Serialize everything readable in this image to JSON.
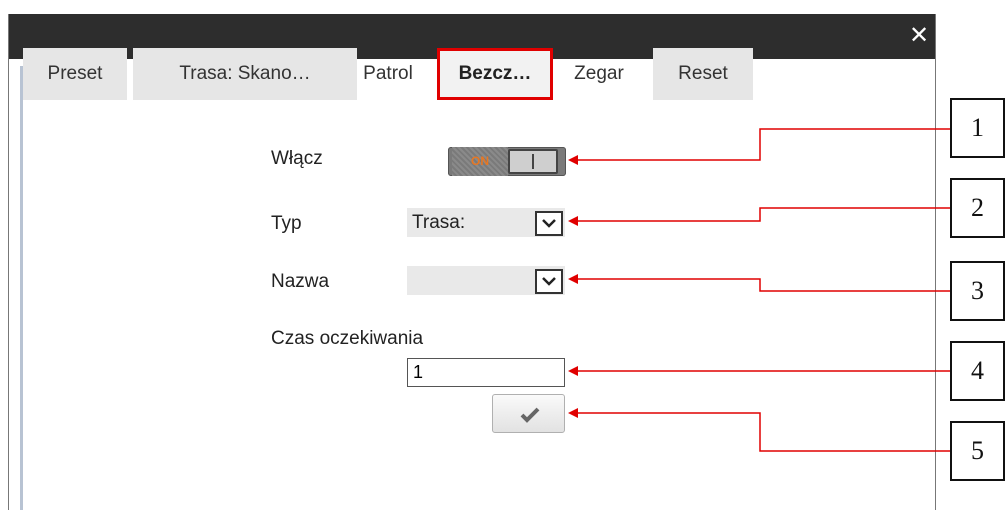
{
  "window": {
    "close_symbol": "✕"
  },
  "tabs": [
    {
      "label": "Preset"
    },
    {
      "label": "Trasa: Skano…"
    },
    {
      "label": "Patrol"
    },
    {
      "label": "Bezcz…",
      "active": true
    },
    {
      "label": "Zegar"
    },
    {
      "label": "Reset"
    }
  ],
  "form": {
    "enable_label": "Włącz",
    "enable_toggle_text": "ON",
    "enable_state": "on",
    "type_label": "Typ",
    "type_value": "Trasa:",
    "name_label": "Nazwa",
    "name_value": "",
    "wait_label": "Czas oczekiwania",
    "wait_value": "1",
    "confirm_icon": "checkmark-icon"
  },
  "callouts": [
    "1",
    "2",
    "3",
    "4",
    "5"
  ],
  "colors": {
    "highlight": "#e00000",
    "titlebar": "#2d2d2d",
    "toggle_on_text": "#e87722"
  }
}
